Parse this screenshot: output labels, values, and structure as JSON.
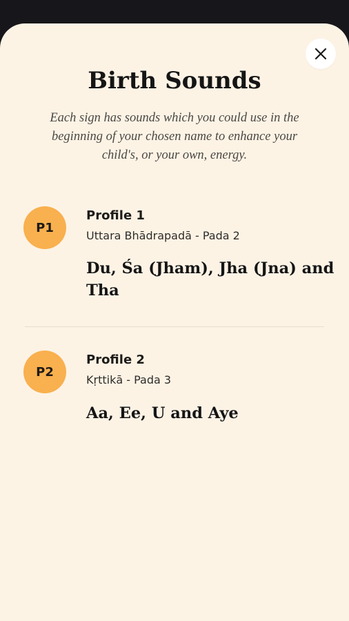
{
  "header": {
    "title": "Birth Sounds",
    "subtitle": "Each sign has sounds which you could use in the beginning of your chosen name to enhance your child's, or your own, energy.",
    "close_icon": "close-icon"
  },
  "profiles": [
    {
      "badge": "P1",
      "name": "Profile 1",
      "nakshatra": "Uttara Bhādrapadā - Pada 2",
      "sounds": "Du, Śa (Jham), Jha (Jna) and Tha"
    },
    {
      "badge": "P2",
      "name": "Profile 2",
      "nakshatra": "Kṛttikā - Pada 3",
      "sounds": "Aa, Ee, U and Aye"
    }
  ],
  "colors": {
    "top_bar": "#17161b",
    "sheet_background": "#fdf3e5",
    "badge": "#f9b04e",
    "close_button": "#ffffff"
  }
}
